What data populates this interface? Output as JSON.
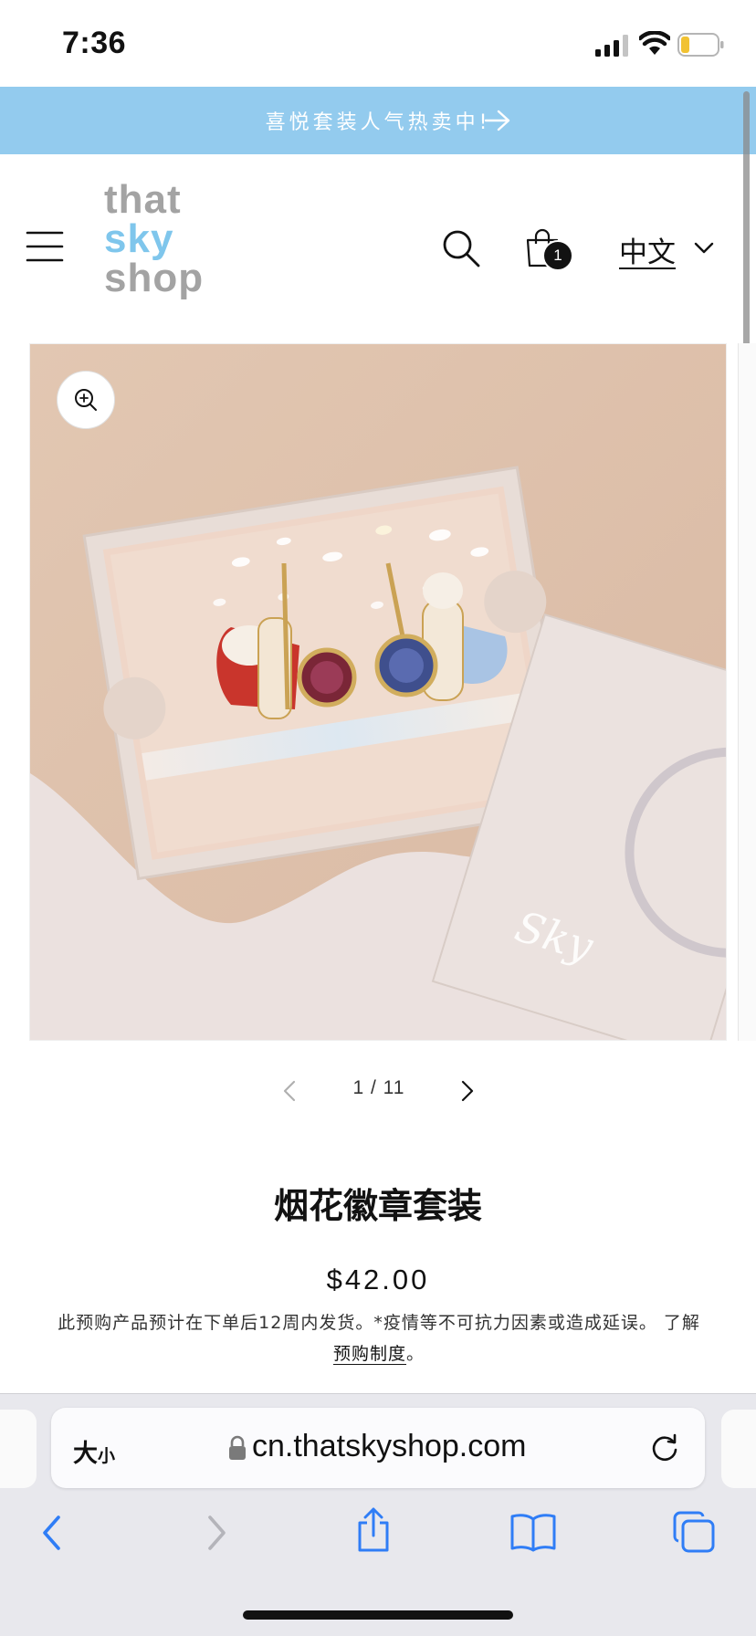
{
  "status_bar": {
    "time": "7:36"
  },
  "announcement": {
    "text": "喜悦套装人气热卖中!",
    "icon": "arrow-right-icon",
    "background": "#93cbee"
  },
  "header": {
    "logo": {
      "line1": "that",
      "line2": "sky",
      "line3": "shop"
    },
    "cart_count": "1",
    "language": "中文",
    "icons": [
      "menu-icon",
      "search-icon",
      "shopping-bag-icon",
      "chevron-down-icon"
    ]
  },
  "gallery": {
    "counter": "1 / 11",
    "zoom_icon": "zoom-in-icon",
    "image_logo": "Sky"
  },
  "product": {
    "title": "烟花徽章套装",
    "price": "$42.00",
    "notice_text": "此预购产品预计在下单后12周内发货。*疫情等不可抗力因素或造成延误。 了解",
    "notice_link": "预购制度",
    "notice_end": "。"
  },
  "browser": {
    "text_size_big": "大",
    "text_size_small": "小",
    "url": "cn.thatskyshop.com",
    "accent": "#2f7df6"
  }
}
